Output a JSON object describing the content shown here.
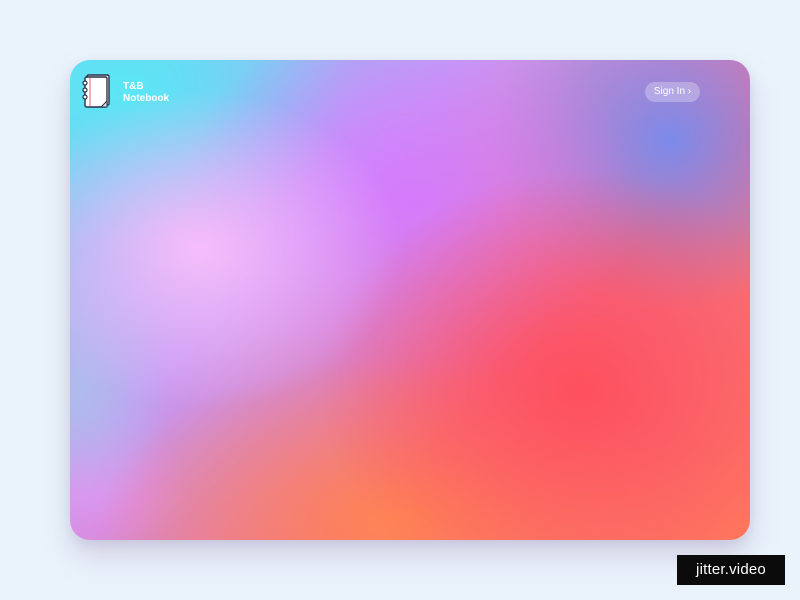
{
  "app": {
    "brand_line1": "T&B",
    "brand_line2": "Notebook",
    "logo_icon": "notebook-icon"
  },
  "header": {
    "signin_label": "Sign In ›"
  },
  "watermark": {
    "text": "jitter.video"
  },
  "colors": {
    "page_background": "#eaf3fc",
    "gradient_cyan": "#5ae6f5",
    "gradient_pink": "#fabefa",
    "gradient_purple": "#d678ff",
    "gradient_blue": "#768cee",
    "gradient_red": "#ff4e5c",
    "gradient_orange": "#ff8750",
    "watermark_bg": "#0b0b0b"
  }
}
